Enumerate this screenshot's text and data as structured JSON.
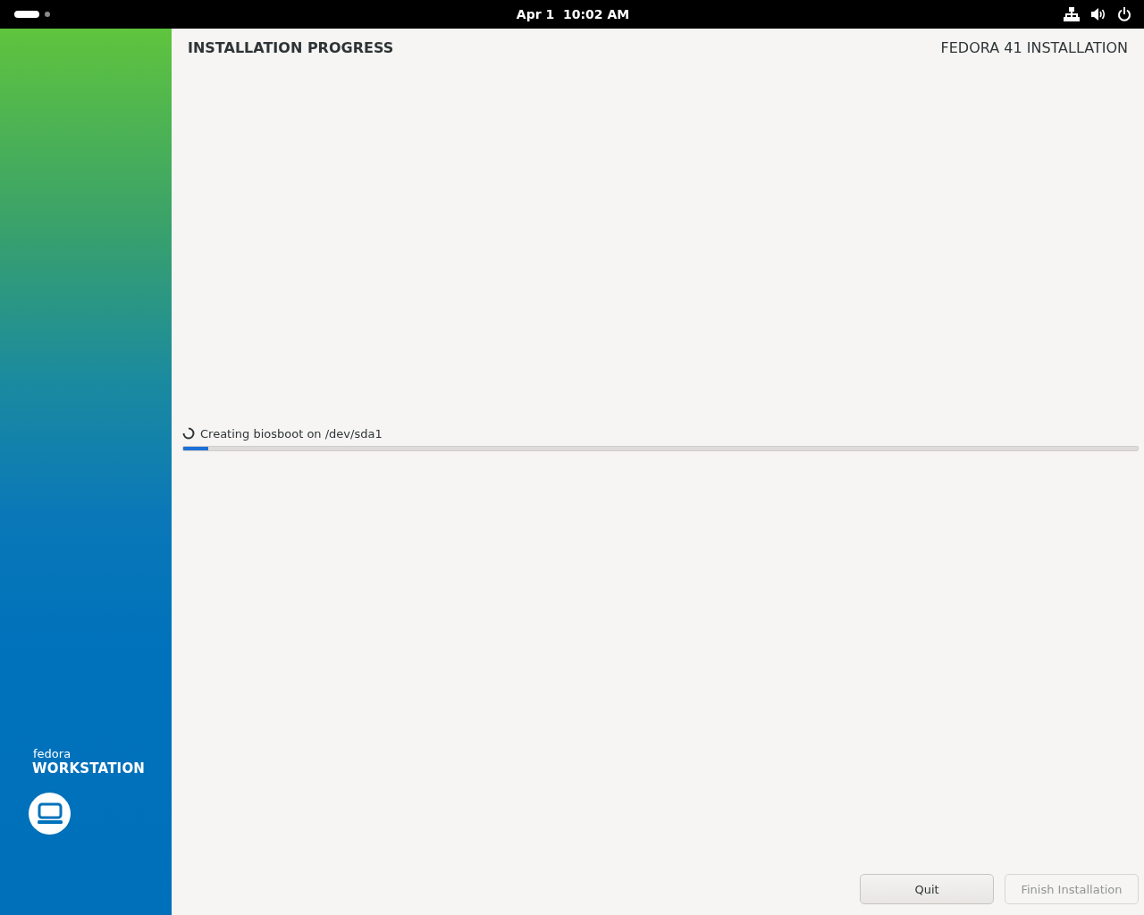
{
  "top_bar": {
    "workspaces": [
      {
        "selected": true
      },
      {
        "selected": false
      }
    ],
    "clock": "Apr 1  10:02 AM"
  },
  "sidebar": {
    "brand": "fedora",
    "edition": "WORKSTATION"
  },
  "header": {
    "title": "INSTALLATION PROGRESS",
    "product": "FEDORA 41 INSTALLATION"
  },
  "progress": {
    "status": "Creating biosboot on /dev/sda1",
    "level": 0.026
  },
  "buttons": [
    {
      "label": "Quit",
      "disabled": false
    },
    {
      "label": "Finish Installation",
      "disabled": true
    }
  ]
}
